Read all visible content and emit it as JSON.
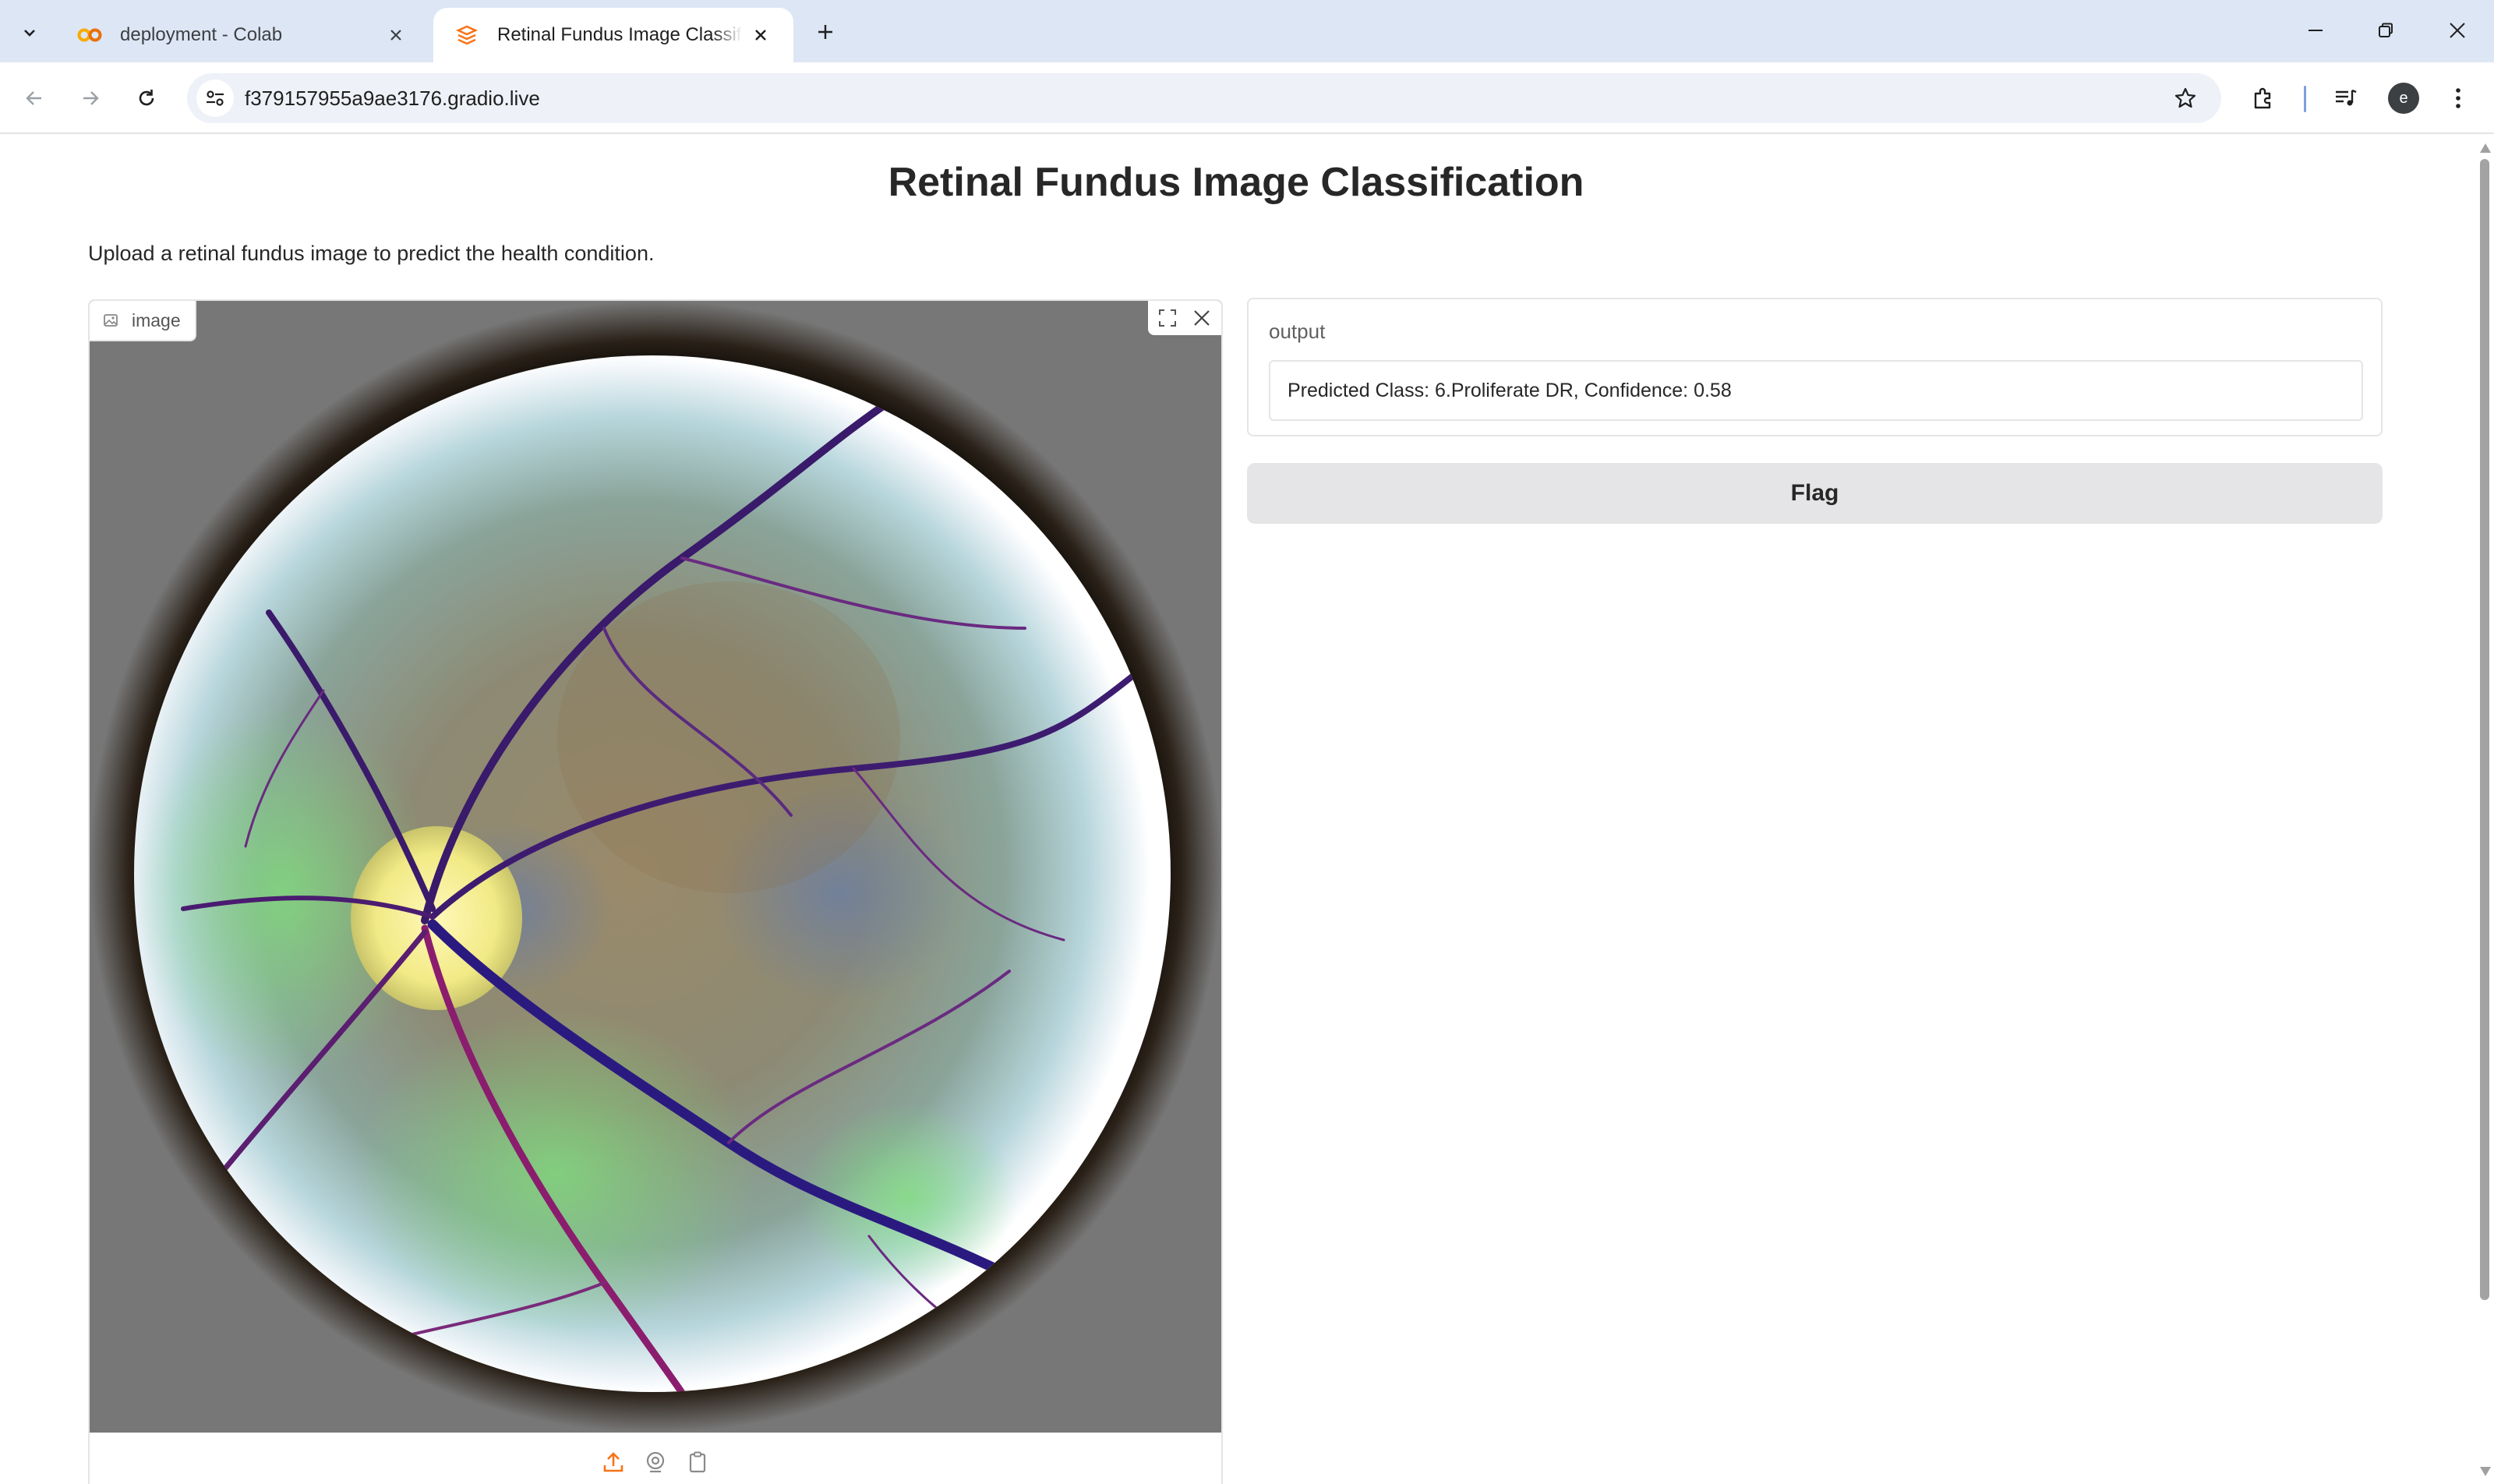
{
  "browser": {
    "tabs": [
      {
        "title": "deployment - Colab",
        "favicon": "colab-icon",
        "active": false
      },
      {
        "title": "Retinal Fundus Image Classification",
        "favicon": "gradio-icon",
        "active": true
      }
    ],
    "url": "f379157955a9ae3176.gradio.live",
    "profile_initial": "e"
  },
  "page": {
    "title": "Retinal Fundus Image Classification",
    "description": "Upload a retinal fundus image to predict the health condition."
  },
  "image_input": {
    "label": "image",
    "icons": [
      "image-icon",
      "fullscreen-icon",
      "close-icon",
      "upload-icon",
      "webcam-icon",
      "clipboard-icon"
    ]
  },
  "output": {
    "label": "output",
    "value": "Predicted Class: 6.Proliferate DR, Confidence: 0.58"
  },
  "flag_button": {
    "label": "Flag"
  },
  "colors": {
    "accent_orange": "#f97316",
    "tab_strip": "#dde6f5",
    "button_gray": "#e5e5e7"
  }
}
